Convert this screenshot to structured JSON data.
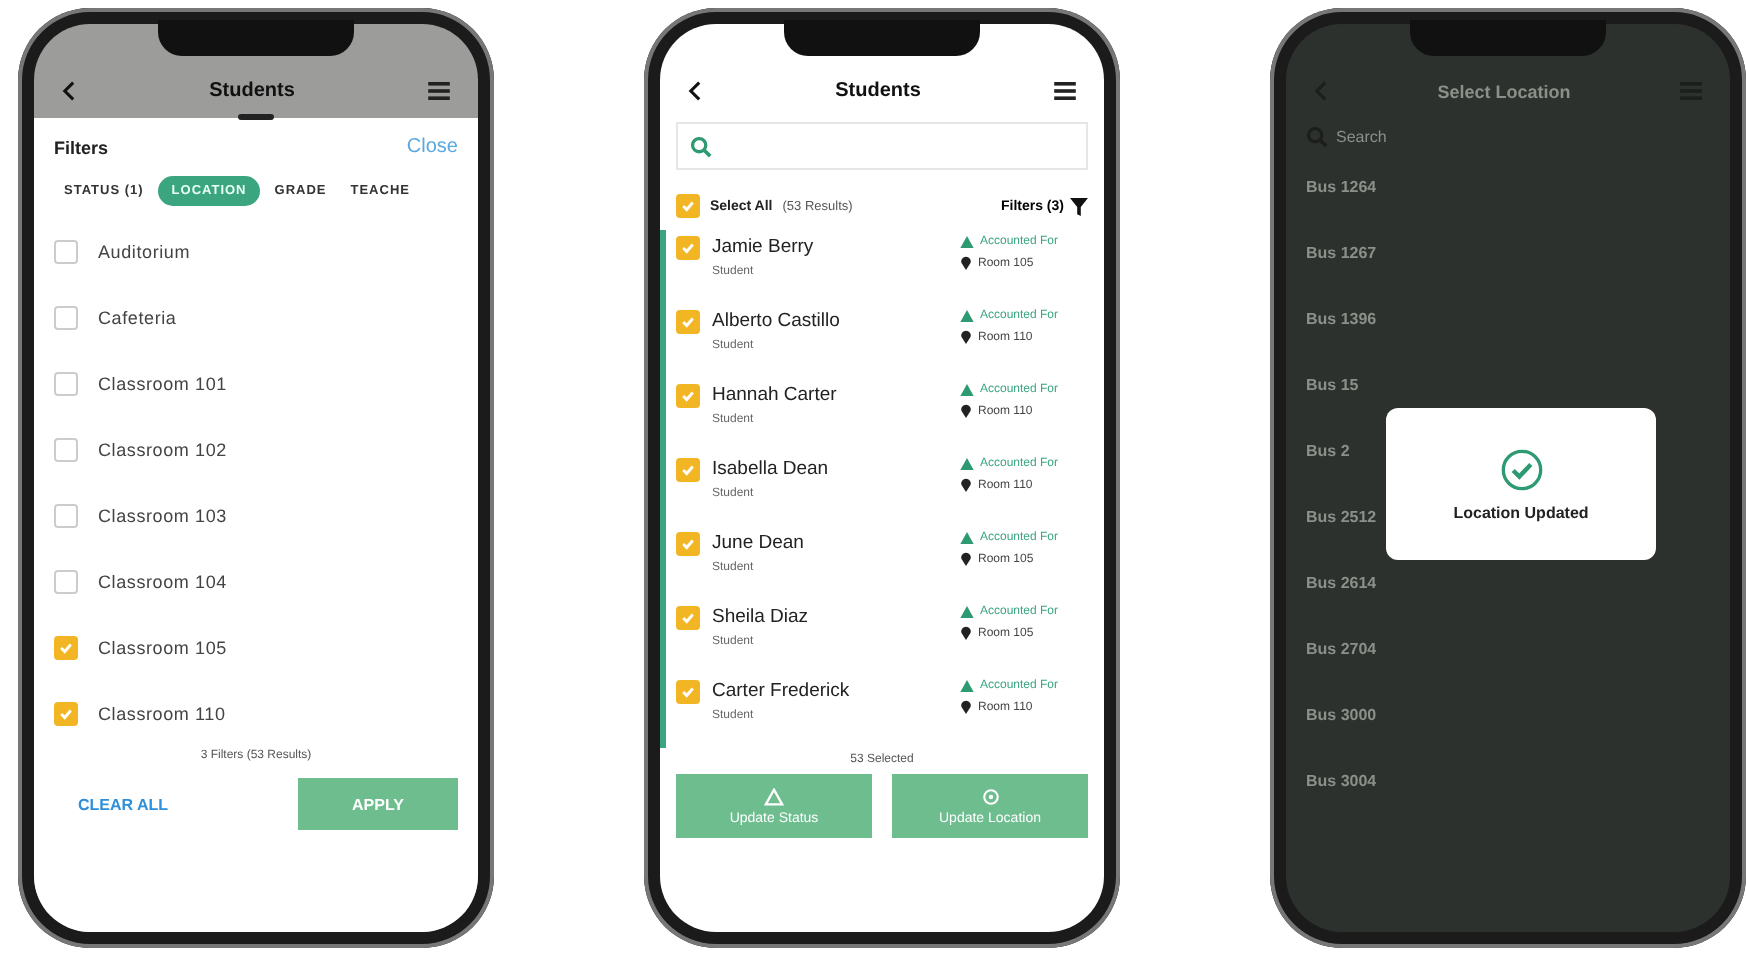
{
  "filter_screen": {
    "title": "Students",
    "sheet_title": "Filters",
    "close": "Close",
    "tabs": [
      {
        "label": "STATUS (1)",
        "selected": false
      },
      {
        "label": "LOCATION",
        "selected": true
      },
      {
        "label": "GRADE",
        "selected": false
      },
      {
        "label": "TEACHE",
        "selected": false
      }
    ],
    "options": [
      {
        "label": "Auditorium",
        "checked": false
      },
      {
        "label": "Cafeteria",
        "checked": false
      },
      {
        "label": "Classroom 101",
        "checked": false
      },
      {
        "label": "Classroom 102",
        "checked": false
      },
      {
        "label": "Classroom 103",
        "checked": false
      },
      {
        "label": "Classroom 104",
        "checked": false
      },
      {
        "label": "Classroom 105",
        "checked": true
      },
      {
        "label": "Classroom 110",
        "checked": true
      }
    ],
    "summary": "3 Filters (53 Results)",
    "clear": "CLEAR ALL",
    "apply": "APPLY"
  },
  "student_screen": {
    "title": "Students",
    "select_all": {
      "label": "Select All",
      "count": "(53 Results)",
      "checked": true
    },
    "filters": "Filters (3)",
    "students": [
      {
        "name": "Jamie Berry",
        "role": "Student",
        "status": "Accounted For",
        "room": "Room 105",
        "checked": true
      },
      {
        "name": "Alberto Castillo",
        "role": "Student",
        "status": "Accounted For",
        "room": "Room 110",
        "checked": true
      },
      {
        "name": "Hannah Carter",
        "role": "Student",
        "status": "Accounted For",
        "room": "Room 110",
        "checked": true
      },
      {
        "name": "Isabella Dean",
        "role": "Student",
        "status": "Accounted For",
        "room": "Room 110",
        "checked": true
      },
      {
        "name": "June Dean",
        "role": "Student",
        "status": "Accounted For",
        "room": "Room 105",
        "checked": true
      },
      {
        "name": "Sheila Diaz",
        "role": "Student",
        "status": "Accounted For",
        "room": "Room 105",
        "checked": true
      },
      {
        "name": "Carter Frederick",
        "role": "Student",
        "status": "Accounted For",
        "room": "Room 110",
        "checked": true
      }
    ],
    "selected_count": "53 Selected",
    "actions": [
      {
        "kind": "status",
        "label": "Update Status"
      },
      {
        "kind": "location",
        "label": "Update Location"
      }
    ]
  },
  "location_screen": {
    "title": "Select Location",
    "search": {
      "placeholder": "Search"
    },
    "items": [
      "Bus 1264",
      "Bus 1267",
      "Bus 1396",
      "Bus 15",
      "Bus 2",
      "Bus 2512",
      "Bus 2614",
      "Bus 2704",
      "Bus 3000",
      "Bus 3004"
    ],
    "dialog": {
      "message": "Location Updated"
    }
  }
}
